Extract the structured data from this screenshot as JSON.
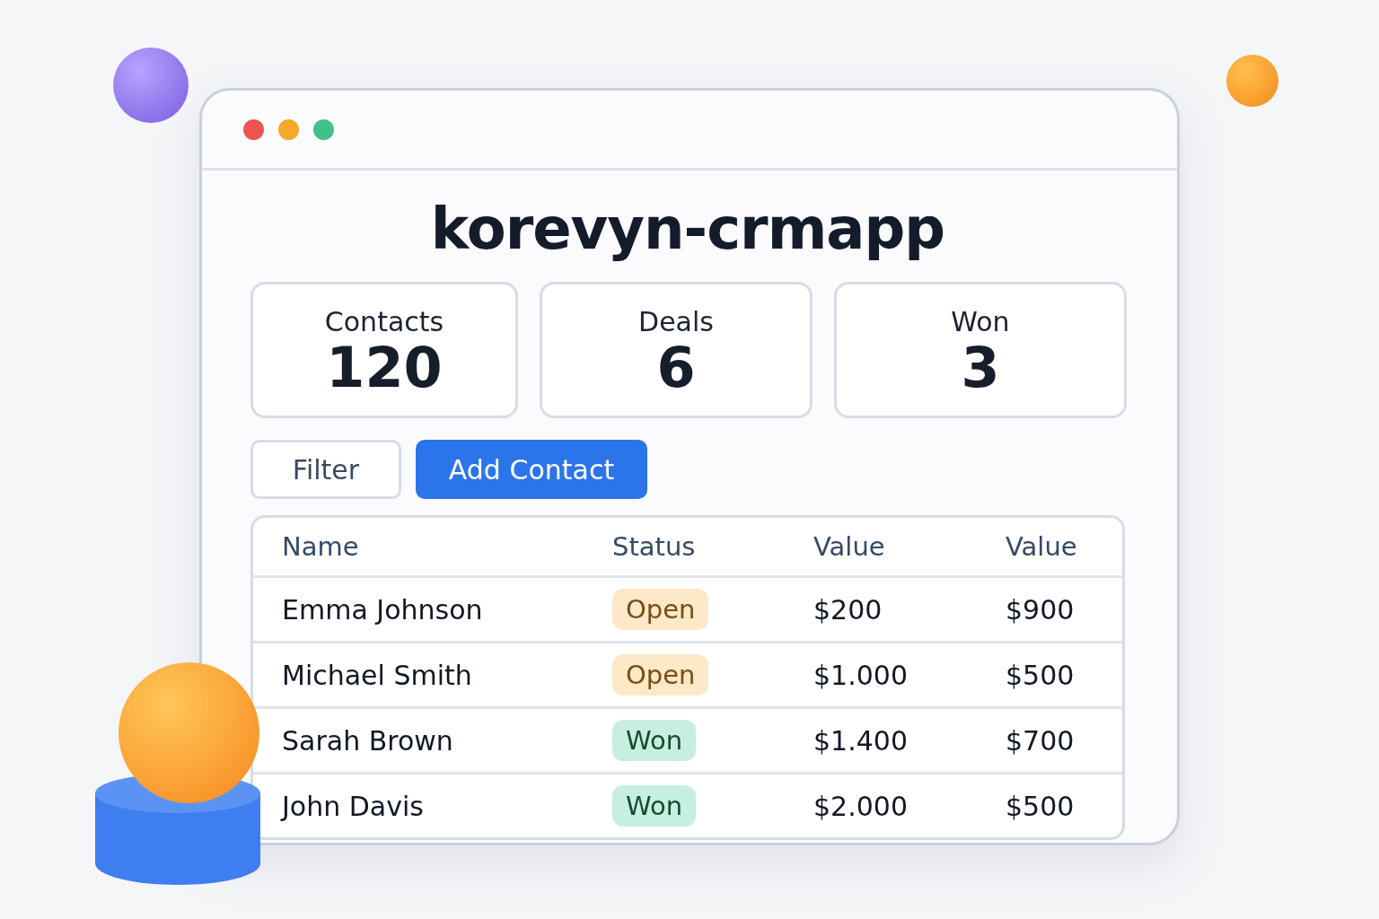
{
  "window": {
    "title": "korevyn-crmapp"
  },
  "stats": [
    {
      "label": "Contacts",
      "value": "120"
    },
    {
      "label": "Deals",
      "value": "6"
    },
    {
      "label": "Won",
      "value": "3"
    }
  ],
  "buttons": [
    {
      "label": "Filter",
      "kind": "secondary"
    },
    {
      "label": "Add Contact",
      "kind": "primary"
    }
  ],
  "table": {
    "columns": [
      "Name",
      "Status",
      "Value",
      "Value"
    ],
    "rows": [
      {
        "name": "Emma Johnson",
        "status": {
          "label": "Open",
          "kind": "open"
        },
        "value_1": "$200",
        "value_2": "$900"
      },
      {
        "name": "Michael Smith",
        "status": {
          "label": "Open",
          "kind": "open"
        },
        "value_1": "$1.000",
        "value_2": "$500"
      },
      {
        "name": "Sarah Brown",
        "status": {
          "label": "Won",
          "kind": "won"
        },
        "value_1": "$1.400",
        "value_2": "$700"
      },
      {
        "name": "John Davis",
        "status": {
          "label": "Won",
          "kind": "won"
        },
        "value_1": "$2.000",
        "value_2": "$500"
      }
    ]
  }
}
